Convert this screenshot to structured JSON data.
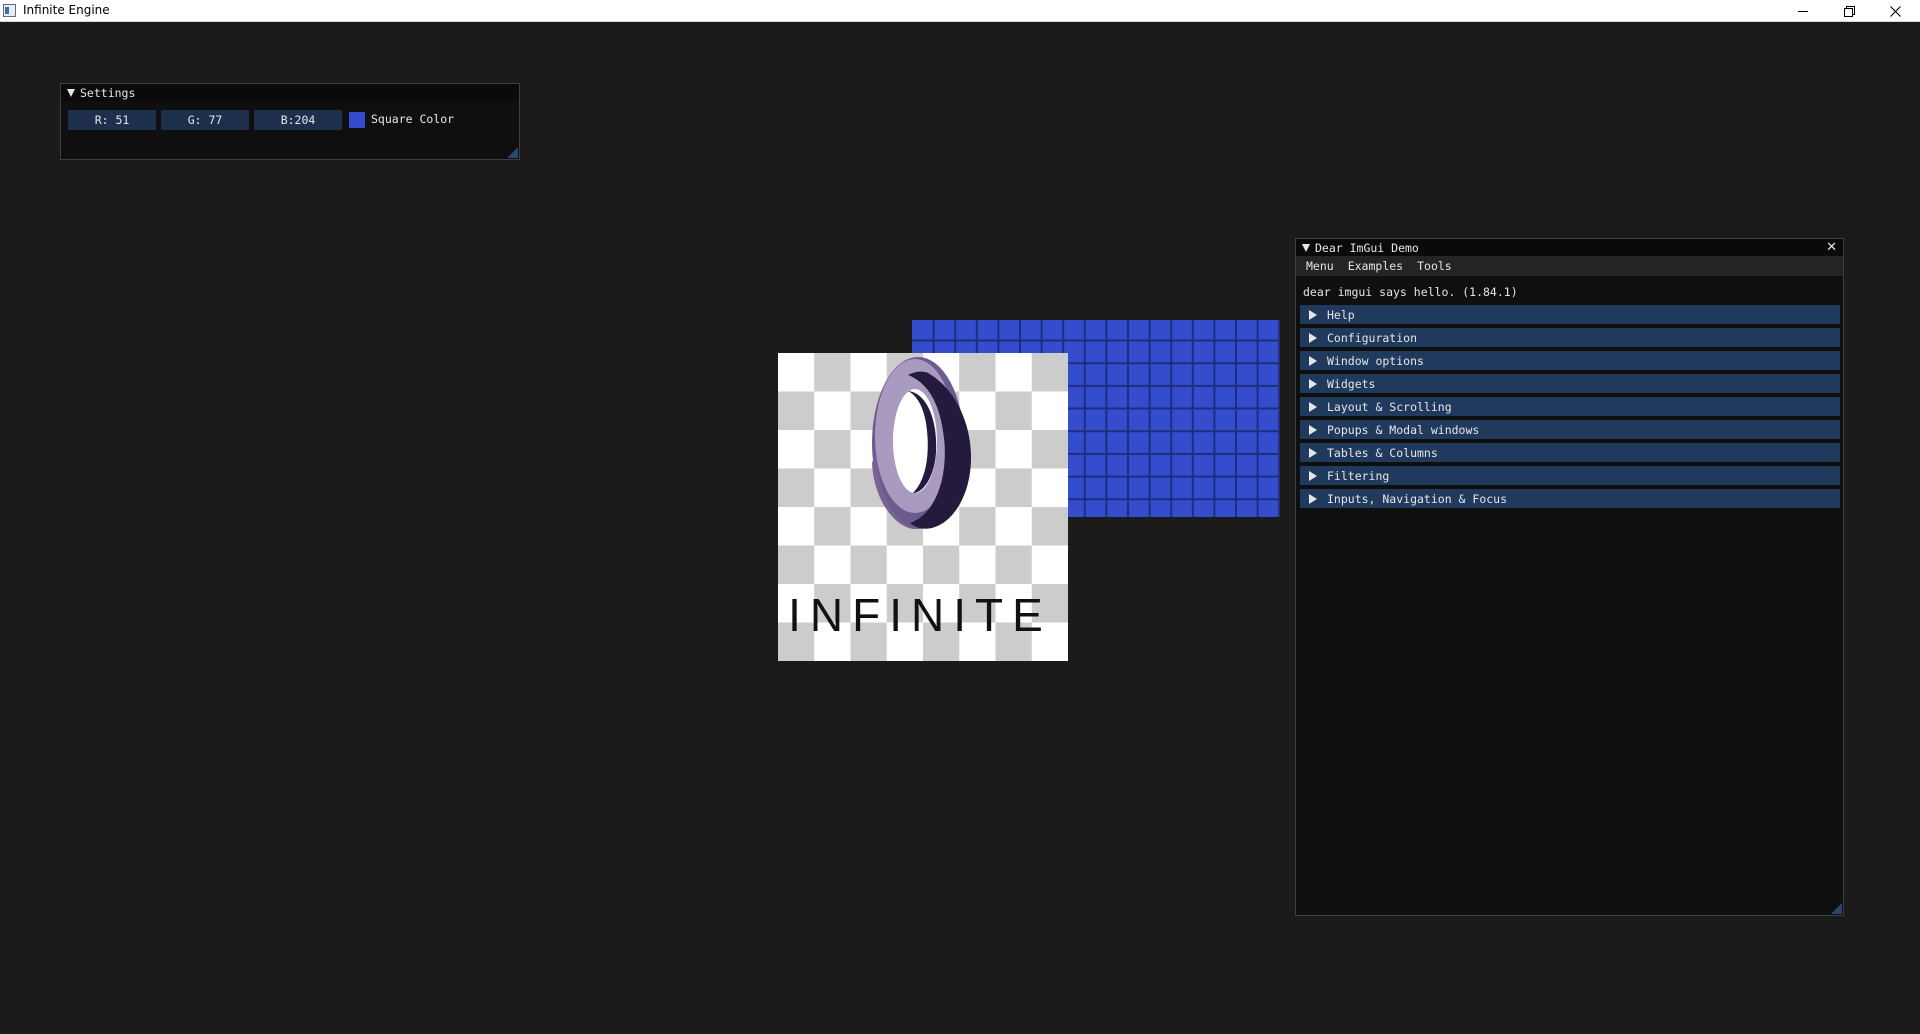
{
  "app": {
    "title": "Infinite Engine",
    "controls": {
      "minimize": "minimize-icon",
      "maximize": "restore-icon",
      "close": "close-icon"
    }
  },
  "settings_window": {
    "title": "Settings",
    "fields": [
      {
        "label": "R: 51"
      },
      {
        "label": "G: 77"
      },
      {
        "label": "B:204"
      }
    ],
    "color_label": "Square Color",
    "color_value": "#334dcc"
  },
  "demo_window": {
    "title": "Dear ImGui Demo",
    "menu": [
      "Menu",
      "Examples",
      "Tools"
    ],
    "hello": "dear imgui says hello. (1.84.1)",
    "sections": [
      "Help",
      "Configuration",
      "Window options",
      "Widgets",
      "Layout & Scrolling",
      "Popups & Modal windows",
      "Tables & Columns",
      "Filtering",
      "Inputs, Navigation & Focus"
    ]
  },
  "scene": {
    "logo_text": "INFINITE",
    "square_color": "#334dcc"
  }
}
